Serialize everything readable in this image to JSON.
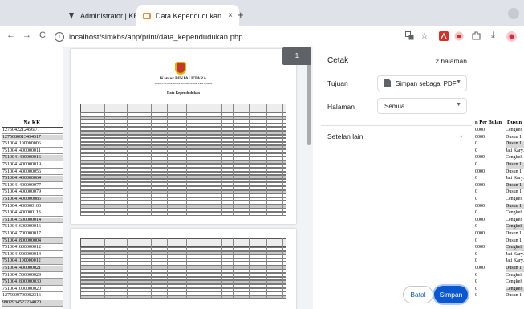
{
  "browser": {
    "tabs": [
      {
        "label": "Administrator | KBS",
        "close": "×"
      },
      {
        "label": "Data Kependudukan",
        "close": "×"
      }
    ],
    "new_tab": "+",
    "url": "localhost/simkbs/app/print/data_kependudukan.php",
    "nav": {
      "back": "←",
      "forward": "→",
      "reload": "C"
    }
  },
  "print_dialog": {
    "title": "Cetak",
    "page_count": "2 halaman",
    "destination_label": "Tujuan",
    "destination_value": "Simpan sebagai PDF",
    "pages_label": "Halaman",
    "pages_value": "Semua",
    "more_settings_label": "Setelan lain",
    "cancel_label": "Batal",
    "save_label": "Simpan",
    "page_badge": "1"
  },
  "preview_doc": {
    "org_name": "Kantor BINJAI UTARA",
    "org_address": "BINJAI UTARA, KOTA BINJAI SUMATERA UTARA",
    "doc_title": "Data Kependudukan",
    "columns": [
      "No KK",
      "NIK",
      "Nama",
      "Jenis Kelamin",
      "Hubungan Keluarga",
      "Tempat Lahir",
      "Tgl Lahir",
      "Agama",
      "Pendidikan",
      "Pekerjaan",
      "Penghasilan Per Bulan",
      "Status"
    ]
  },
  "background": {
    "left_header": "No KK",
    "left_rows": [
      "1275042212456/71",
      "1275080013434517",
      "7510041100000006",
      "7510041400000011",
      "7510041400000016",
      "7510041400000019",
      "7510041400000056",
      "7510041400000064",
      "7510041400000077",
      "7510041400000079",
      "7510041400000085",
      "7510041400000100",
      "7510041400000113",
      "7510041500000014",
      "7510041600000016",
      "7510041700000017",
      "7510041800000004",
      "7510041800000012",
      "7510041900000014",
      "7510041100000012",
      "7510041400000021",
      "7510041500000029",
      "7510041800000030",
      "7510041000000020",
      "1275000700082316",
      "9902934522234020"
    ],
    "right_header": "n Per Bulan",
    "right_status_header": "Dusun",
    "right_rows": [
      {
        "income": "0000",
        "dusun": "Cengkeh 1"
      },
      {
        "income": "0000",
        "dusun": "Dusun 1"
      },
      {
        "income": "0",
        "dusun": "Dusun 1"
      },
      {
        "income": "0",
        "dusun": "Jati Kary."
      },
      {
        "income": "0000",
        "dusun": "Cengkeh 1"
      },
      {
        "income": "0",
        "dusun": "Dusun 1"
      },
      {
        "income": "0000",
        "dusun": "Dusun 1"
      },
      {
        "income": "0",
        "dusun": "Jati Kary."
      },
      {
        "income": "0000",
        "dusun": "Dusun 1"
      },
      {
        "income": "0",
        "dusun": "Dusun 1"
      },
      {
        "income": "0",
        "dusun": "Cengkeh 1"
      },
      {
        "income": "0000",
        "dusun": "Dusun 1"
      },
      {
        "income": "0",
        "dusun": "Cengkeh 1"
      },
      {
        "income": "0000",
        "dusun": "Cengkeh 1"
      },
      {
        "income": "0",
        "dusun": "Cengkeh 1"
      },
      {
        "income": "0000",
        "dusun": "Dusun 1"
      },
      {
        "income": "0",
        "dusun": "Dusun 1"
      },
      {
        "income": "0000",
        "dusun": "Cengkeh 1"
      },
      {
        "income": "0",
        "dusun": "Jati Kary."
      },
      {
        "income": "0",
        "dusun": "Jati Kary."
      },
      {
        "income": "0000",
        "dusun": "Dusun 1"
      },
      {
        "income": "0",
        "dusun": "Cengkeh 1"
      },
      {
        "income": "0",
        "dusun": "Cengkeh 1"
      },
      {
        "income": "0",
        "dusun": "Cengkeh 1"
      },
      {
        "income": "0",
        "dusun": "Dusun 1"
      }
    ]
  },
  "colors": {
    "accent": "#0b57d0",
    "tab_bar": "#dfe3e9",
    "page_bg": "#808080"
  },
  "icons": [
    "kbs-tab-icon",
    "folder-tab-icon",
    "info-icon",
    "translate-icon",
    "bookmark-star-icon",
    "pdf-extension-icon",
    "extension-icon",
    "puzzle-icon",
    "download-icon",
    "avatar-icon",
    "pdf-file-icon",
    "chevron-down-icon"
  ]
}
